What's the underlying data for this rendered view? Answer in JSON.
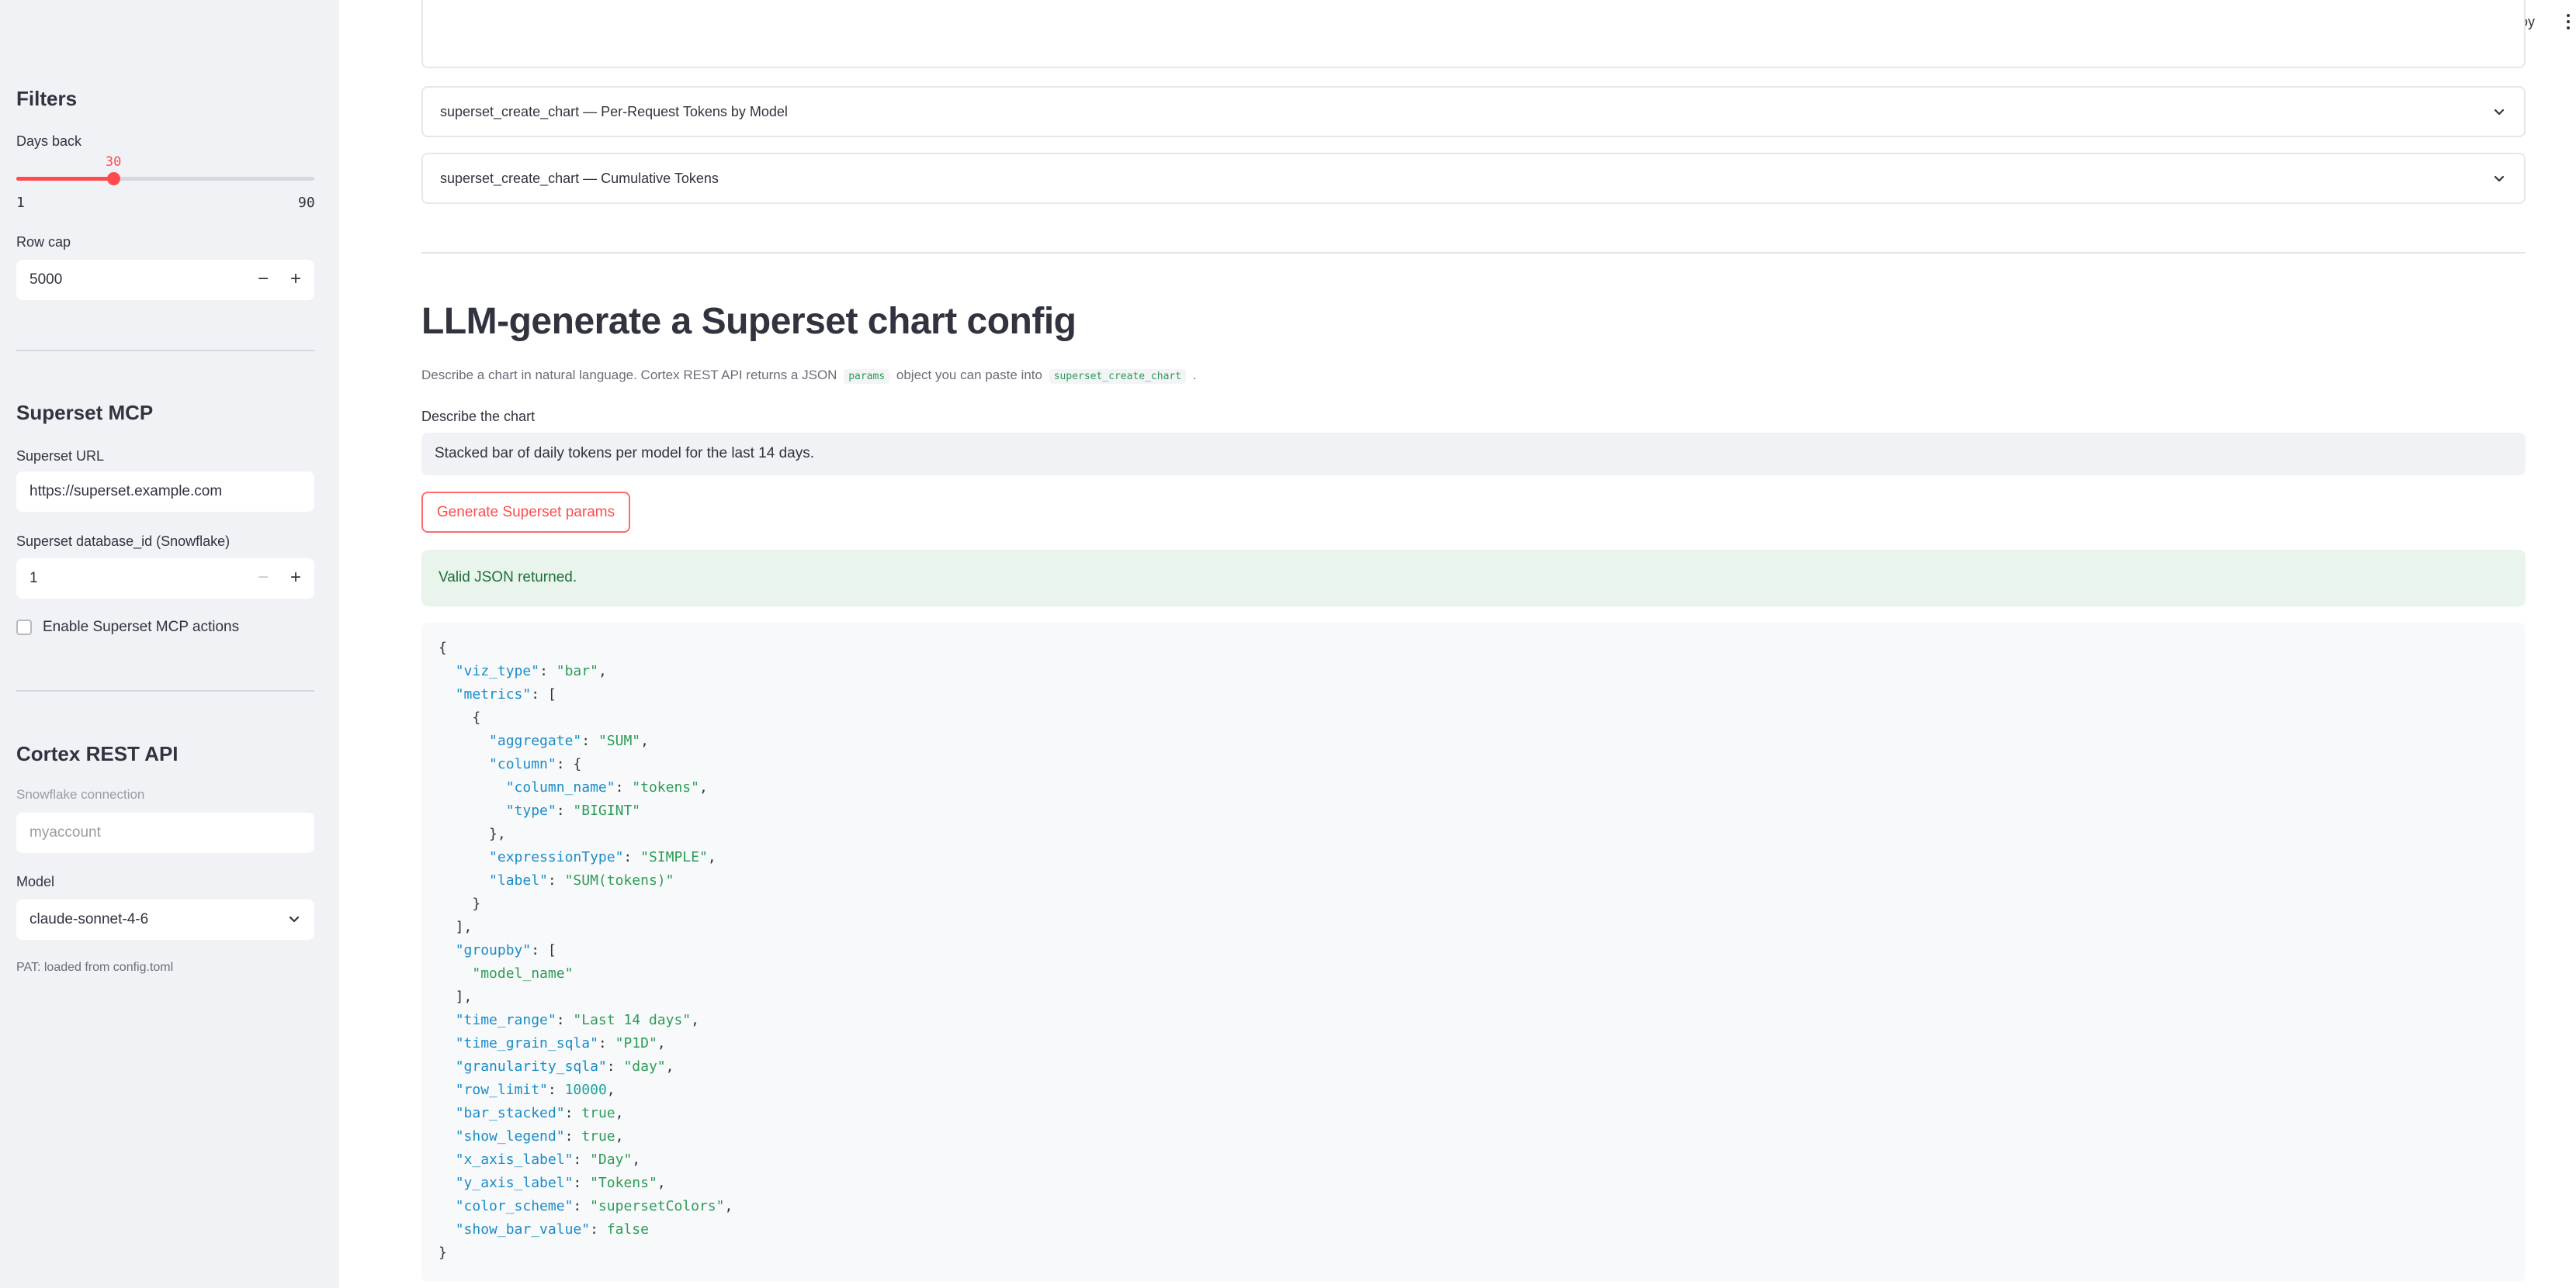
{
  "sidebar": {
    "filters": {
      "heading": "Filters",
      "days_back_label": "Days back",
      "days_back_value": "30",
      "days_back_min": "1",
      "days_back_max": "90",
      "days_back_fraction": 0.3258,
      "row_cap_label": "Row cap",
      "row_cap_value": "5000"
    },
    "superset": {
      "heading": "Superset MCP",
      "url_label": "Superset URL",
      "url_value": "https://superset.example.com",
      "db_label": "Superset database_id (Snowflake)",
      "db_value": "1",
      "enable_label": "Enable Superset MCP actions"
    },
    "cortex": {
      "heading": "Cortex REST API",
      "conn_label": "Snowflake connection",
      "conn_placeholder": "myaccount",
      "model_label": "Model",
      "model_value": "claude-sonnet-4-6",
      "pat_note": "PAT: loaded from config.toml"
    }
  },
  "topbar": {
    "deploy_label": "Deploy"
  },
  "main": {
    "expanders": [
      "superset_create_chart — Per-Request Tokens by Model",
      "superset_create_chart — Cumulative Tokens"
    ],
    "title": "LLM-generate a Superset chart config",
    "desc_pre": "Describe a chart in natural language. Cortex REST API returns a JSON",
    "desc_code1": "params",
    "desc_mid": "object you can paste into",
    "desc_code2": "superset_create_chart",
    "desc_post": ".",
    "describe_label": "Describe the chart",
    "describe_value": "Stacked bar of daily tokens per model for the last 14 days.",
    "generate_button": "Generate Superset params",
    "success_message": "Valid JSON returned.",
    "code_lines": [
      [
        [
          "p",
          "{"
        ]
      ],
      [
        [
          "p",
          "  "
        ],
        [
          "k",
          "\"viz_type\""
        ],
        [
          "p",
          ": "
        ],
        [
          "s",
          "\"bar\""
        ],
        [
          "p",
          ","
        ]
      ],
      [
        [
          "p",
          "  "
        ],
        [
          "k",
          "\"metrics\""
        ],
        [
          "p",
          ": ["
        ]
      ],
      [
        [
          "p",
          "    {"
        ]
      ],
      [
        [
          "p",
          "      "
        ],
        [
          "k",
          "\"aggregate\""
        ],
        [
          "p",
          ": "
        ],
        [
          "s",
          "\"SUM\""
        ],
        [
          "p",
          ","
        ]
      ],
      [
        [
          "p",
          "      "
        ],
        [
          "k",
          "\"column\""
        ],
        [
          "p",
          ": {"
        ]
      ],
      [
        [
          "p",
          "        "
        ],
        [
          "k",
          "\"column_name\""
        ],
        [
          "p",
          ": "
        ],
        [
          "s",
          "\"tokens\""
        ],
        [
          "p",
          ","
        ]
      ],
      [
        [
          "p",
          "        "
        ],
        [
          "k",
          "\"type\""
        ],
        [
          "p",
          ": "
        ],
        [
          "s",
          "\"BIGINT\""
        ]
      ],
      [
        [
          "p",
          "      },"
        ]
      ],
      [
        [
          "p",
          "      "
        ],
        [
          "k",
          "\"expressionType\""
        ],
        [
          "p",
          ": "
        ],
        [
          "s",
          "\"SIMPLE\""
        ],
        [
          "p",
          ","
        ]
      ],
      [
        [
          "p",
          "      "
        ],
        [
          "k",
          "\"label\""
        ],
        [
          "p",
          ": "
        ],
        [
          "s",
          "\"SUM(tokens)\""
        ]
      ],
      [
        [
          "p",
          "    }"
        ]
      ],
      [
        [
          "p",
          "  ],"
        ]
      ],
      [
        [
          "p",
          "  "
        ],
        [
          "k",
          "\"groupby\""
        ],
        [
          "p",
          ": ["
        ]
      ],
      [
        [
          "p",
          "    "
        ],
        [
          "s",
          "\"model_name\""
        ]
      ],
      [
        [
          "p",
          "  ],"
        ]
      ],
      [
        [
          "p",
          "  "
        ],
        [
          "k",
          "\"time_range\""
        ],
        [
          "p",
          ": "
        ],
        [
          "s",
          "\"Last 14 days\""
        ],
        [
          "p",
          ","
        ]
      ],
      [
        [
          "p",
          "  "
        ],
        [
          "k",
          "\"time_grain_sqla\""
        ],
        [
          "p",
          ": "
        ],
        [
          "s",
          "\"P1D\""
        ],
        [
          "p",
          ","
        ]
      ],
      [
        [
          "p",
          "  "
        ],
        [
          "k",
          "\"granularity_sqla\""
        ],
        [
          "p",
          ": "
        ],
        [
          "s",
          "\"day\""
        ],
        [
          "p",
          ","
        ]
      ],
      [
        [
          "p",
          "  "
        ],
        [
          "k",
          "\"row_limit\""
        ],
        [
          "p",
          ": "
        ],
        [
          "n",
          "10000"
        ],
        [
          "p",
          ","
        ]
      ],
      [
        [
          "p",
          "  "
        ],
        [
          "k",
          "\"bar_stacked\""
        ],
        [
          "p",
          ": "
        ],
        [
          "b",
          "true"
        ],
        [
          "p",
          ","
        ]
      ],
      [
        [
          "p",
          "  "
        ],
        [
          "k",
          "\"show_legend\""
        ],
        [
          "p",
          ": "
        ],
        [
          "b",
          "true"
        ],
        [
          "p",
          ","
        ]
      ],
      [
        [
          "p",
          "  "
        ],
        [
          "k",
          "\"x_axis_label\""
        ],
        [
          "p",
          ": "
        ],
        [
          "s",
          "\"Day\""
        ],
        [
          "p",
          ","
        ]
      ],
      [
        [
          "p",
          "  "
        ],
        [
          "k",
          "\"y_axis_label\""
        ],
        [
          "p",
          ": "
        ],
        [
          "s",
          "\"Tokens\""
        ],
        [
          "p",
          ","
        ]
      ],
      [
        [
          "p",
          "  "
        ],
        [
          "k",
          "\"color_scheme\""
        ],
        [
          "p",
          ": "
        ],
        [
          "s",
          "\"supersetColors\""
        ],
        [
          "p",
          ","
        ]
      ],
      [
        [
          "p",
          "  "
        ],
        [
          "k",
          "\"show_bar_value\""
        ],
        [
          "p",
          ": "
        ],
        [
          "b",
          "false"
        ]
      ],
      [
        [
          "p",
          "}"
        ]
      ]
    ]
  },
  "colors": {
    "accent": "#ff4b4b",
    "success_bg": "#e9f5ec",
    "success_text": "#1e6f3a",
    "sidebar_bg": "#f0f2f6",
    "json_key": "#1a8cc7",
    "json_string": "#2c9c56",
    "json_number": "#20a29b"
  }
}
